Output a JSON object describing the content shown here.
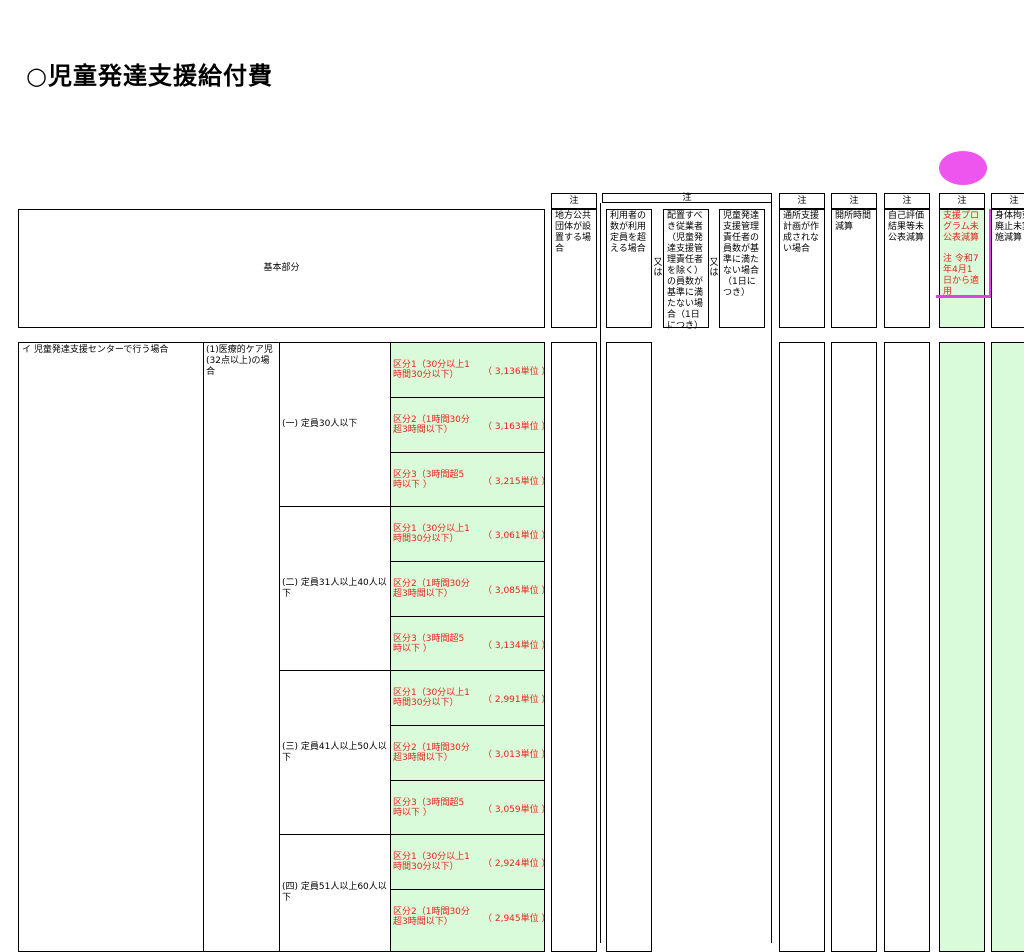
{
  "page": {
    "title": "○児童発達支援給付費"
  },
  "header": {
    "base": "基本部分",
    "note": "注",
    "or": "又は",
    "columns": [
      "地方公共団体が設置する場合",
      "利用者の数が利用定員を超える場合",
      "配置すべき従業者（児童発達支援管理責任者を除く）の員数が基準に満たない場合（1日につき）",
      "児童発達支援管理責任者の員数が基準に満たない場合（1日につき）",
      "通所支援計画が作成されない場合",
      "開所時間減算",
      "自己評価結果等未公表減算",
      "身体拘束廃止未実施減算"
    ],
    "highlight": {
      "title": "支援プログラム未公表減算",
      "note": "注 令和7年4月1日から適用"
    }
  },
  "body": {
    "category": "イ 児童発達支援センターで行う場合",
    "subcategory": "(1)医療的ケア児(32点以上)の場合",
    "groups": [
      {
        "label": "(一) 定員30人以下",
        "rows": [
          {
            "code": "区分1（30分以上1時間30分以下）",
            "unit": "（ 3,136単位 ）"
          },
          {
            "code": "区分2（1時間30分超3時間以下）",
            "unit": "（ 3,163単位 ）"
          },
          {
            "code": "区分3（3時間超5時以下 ）",
            "unit": "（ 3,215単位 ）"
          }
        ]
      },
      {
        "label": "(二) 定員31人以上40人以下",
        "rows": [
          {
            "code": "区分1（30分以上1時間30分以下）",
            "unit": "（ 3,061単位 ）"
          },
          {
            "code": "区分2（1時間30分超3時間以下）",
            "unit": "（ 3,085単位 ）"
          },
          {
            "code": "区分3（3時間超5時以下 ）",
            "unit": "（ 3,134単位 ）"
          }
        ]
      },
      {
        "label": "(三) 定員41人以上50人以下",
        "rows": [
          {
            "code": "区分1（30分以上1時間30分以下）",
            "unit": "（ 2,991単位 ）"
          },
          {
            "code": "区分2（1時間30分超3時間以下）",
            "unit": "（ 3,013単位 ）"
          },
          {
            "code": "区分3（3時間超5時以下 ）",
            "unit": "（ 3,059単位 ）"
          }
        ]
      },
      {
        "label": "(四) 定員51人以上60人以下",
        "rows": [
          {
            "code": "区分1（30分以上1時間30分以下）",
            "unit": "（ 2,924単位 ）"
          },
          {
            "code": "区分2（1時間30分超3時間以下）",
            "unit": "（ 2,945単位 ）"
          }
        ]
      }
    ]
  },
  "colors": {
    "green": "#d9fbd9",
    "red": "#e8231d",
    "highlight": "#e040e8"
  }
}
